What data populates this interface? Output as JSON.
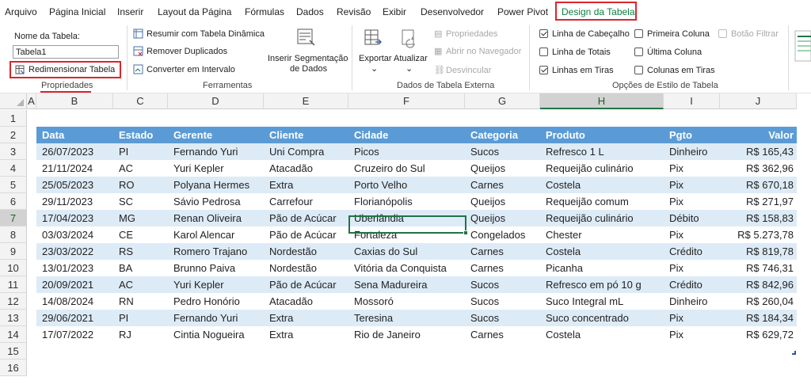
{
  "menu": {
    "items": [
      "Arquivo",
      "Página Inicial",
      "Inserir",
      "Layout da Página",
      "Fórmulas",
      "Dados",
      "Revisão",
      "Exibir",
      "Desenvolvedor",
      "Power Pivot"
    ],
    "active": "Design da Tabela"
  },
  "ribbon": {
    "props": {
      "name_label": "Nome da Tabela:",
      "name_value": "Tabela1",
      "resize": "Redimensionar Tabela",
      "group": "Propriedades"
    },
    "tools": {
      "pivot": "Resumir com Tabela Dinâmica",
      "dup": "Remover Duplicados",
      "convert": "Converter em Intervalo",
      "slicer_1": "Inserir Segmentação",
      "slicer_2": "de Dados",
      "group": "Ferramentas"
    },
    "external": {
      "export": "Exportar",
      "refresh": "Atualizar",
      "properties": "Propriedades",
      "open_browser": "Abrir no Navegador",
      "unlink": "Desvincular",
      "group": "Dados de Tabela Externa"
    },
    "style_opts": {
      "header_row": "Linha de Cabeçalho",
      "total_row": "Linha de Totais",
      "banded_rows": "Linhas em Tiras",
      "first_col": "Primeira Coluna",
      "last_col": "Última Coluna",
      "banded_cols": "Colunas em Tiras",
      "filter_btn": "Botão Filtrar",
      "group": "Opções de Estilo de Tabela",
      "checked": {
        "header_row": true,
        "total_row": false,
        "banded_rows": true,
        "first_col": false,
        "last_col": false,
        "banded_cols": false,
        "filter_btn": false
      }
    }
  },
  "grid": {
    "columns": [
      "A",
      "B",
      "C",
      "D",
      "E",
      "F",
      "G",
      "H",
      "I",
      "J"
    ],
    "selected_column": "H",
    "rows": [
      "1",
      "2",
      "3",
      "4",
      "5",
      "6",
      "7",
      "8",
      "9",
      "10",
      "11",
      "12",
      "13",
      "14",
      "15",
      "16"
    ],
    "selected_row": "7",
    "colors": {
      "header": "#5b9bd5",
      "band": "#ddebf7",
      "selection": "#217346"
    }
  },
  "table": {
    "headers": [
      "Data",
      "Estado",
      "Gerente",
      "Cliente",
      "Cidade",
      "Categoria",
      "Produto",
      "Pgto",
      "Valor"
    ],
    "rows": [
      [
        "26/07/2023",
        "PI",
        "Fernando Yuri",
        "Uni Compra",
        "Picos",
        "Sucos",
        "Refresco 1 L",
        "Dinheiro",
        "R$ 165,43"
      ],
      [
        "21/11/2024",
        "AC",
        "Yuri Kepler",
        "Atacadão",
        "Cruzeiro do Sul",
        "Queijos",
        "Requeijão culinário",
        "Pix",
        "R$ 362,96"
      ],
      [
        "25/05/2023",
        "RO",
        "Polyana Hermes",
        "Extra",
        "Porto Velho",
        "Carnes",
        "Costela",
        "Pix",
        "R$ 670,18"
      ],
      [
        "29/11/2023",
        "SC",
        "Sávio Pedrosa",
        "Carrefour",
        "Florianópolis",
        "Queijos",
        "Requeijão comum",
        "Pix",
        "R$ 271,97"
      ],
      [
        "17/04/2023",
        "MG",
        "Renan Oliveira",
        "Pão de Acúcar",
        "Uberlândia",
        "Queijos",
        "Requeijão culinário",
        "Débito",
        "R$ 158,83"
      ],
      [
        "03/03/2024",
        "CE",
        "Karol Alencar",
        "Pão de Acúcar",
        "Fortaleza",
        "Congelados",
        "Chester",
        "Pix",
        "R$ 5.273,78"
      ],
      [
        "23/03/2022",
        "RS",
        "Romero Trajano",
        "Nordestão",
        "Caxias do Sul",
        "Carnes",
        "Costela",
        "Crédito",
        "R$ 819,78"
      ],
      [
        "13/01/2023",
        "BA",
        "Brunno Paiva",
        "Nordestão",
        "Vitória da Conquista",
        "Carnes",
        "Picanha",
        "Pix",
        "R$ 746,31"
      ],
      [
        "20/09/2021",
        "AC",
        "Yuri Kepler",
        "Pão de Acúcar",
        "Sena Madureira",
        "Sucos",
        "Refresco em pó 10 g",
        "Crédito",
        "R$ 842,96"
      ],
      [
        "14/08/2024",
        "RN",
        "Pedro Honório",
        "Atacadão",
        "Mossoró",
        "Sucos",
        "Suco Integral mL",
        "Dinheiro",
        "R$ 260,04"
      ],
      [
        "29/06/2021",
        "PI",
        "Fernando Yuri",
        "Extra",
        "Teresina",
        "Sucos",
        "Suco concentrado",
        "Pix",
        "R$ 184,34"
      ],
      [
        "17/07/2022",
        "RJ",
        "Cintia Nogueira",
        "Extra",
        "Rio de Janeiro",
        "Carnes",
        "Costela",
        "Pix",
        "R$ 629,72"
      ]
    ]
  }
}
